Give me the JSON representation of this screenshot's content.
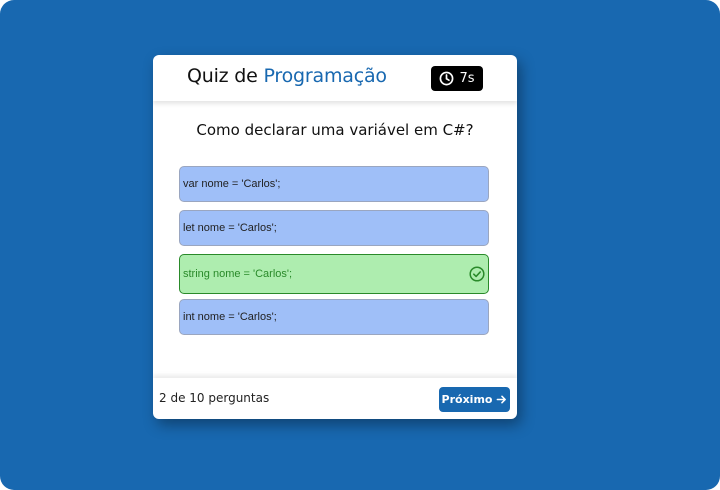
{
  "quiz": {
    "title_prefix": "Quiz de",
    "title_accent": "Programação",
    "timer": "7s",
    "question": "Como declarar uma variável em C#?",
    "options": [
      {
        "label": "var nome = 'Carlos';",
        "state": "default"
      },
      {
        "label": "let nome = 'Carlos';",
        "state": "default"
      },
      {
        "label": "string nome = 'Carlos';",
        "state": "correct"
      },
      {
        "label": "int nome = 'Carlos';",
        "state": "default"
      }
    ],
    "progress": "2 de 10 perguntas",
    "next_label": "Próximo"
  },
  "icons": {
    "timer": "clock-icon",
    "correct": "check-circle-icon",
    "next": "arrow-right-icon"
  },
  "colors": {
    "background": "#1868b0",
    "accent": "#1868b0",
    "option_default": "#9fbff8",
    "option_correct": "#aeedaf",
    "correct_text": "#2a8a2a"
  }
}
